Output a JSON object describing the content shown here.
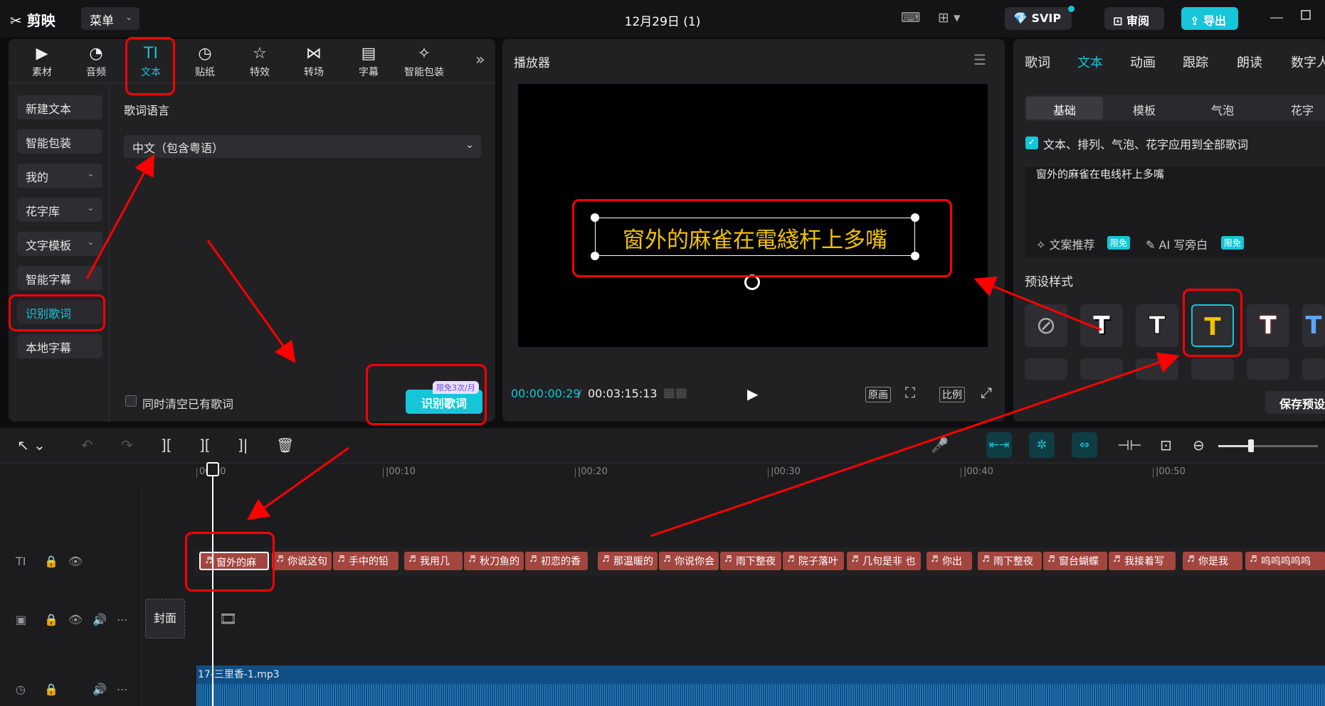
{
  "app": {
    "logo": "✂ 剪映",
    "menu": "菜单",
    "title": "12月29日 (1)",
    "svip": "SVIP",
    "review": "审阅",
    "export": "导出"
  },
  "left_tabs": [
    {
      "label": "素材",
      "icon": "▶"
    },
    {
      "label": "音频",
      "icon": "◔"
    },
    {
      "label": "文本",
      "icon": "TI"
    },
    {
      "label": "贴纸",
      "icon": "◷"
    },
    {
      "label": "特效",
      "icon": "☆"
    },
    {
      "label": "转场",
      "icon": "⋈"
    },
    {
      "label": "字幕",
      "icon": "▤"
    },
    {
      "label": "智能包装",
      "icon": "✧"
    }
  ],
  "sidebar": [
    "新建文本",
    "智能包装",
    "我的",
    "花字库",
    "文字模板",
    "智能字幕",
    "识别歌词",
    "本地字幕"
  ],
  "lyrics": {
    "lang_label": "歌词语言",
    "lang_value": "中文（包含粤语）",
    "clear_label": "同时清空已有歌词",
    "recognize": "识别歌词",
    "limit": "限免3次/月"
  },
  "player": {
    "title": "播放器",
    "caption": "窗外的麻雀在電綫杆上多嘴",
    "time_current": "00:00:00:29",
    "time_sep": "/",
    "time_total": "00:03:15:13",
    "orig": "原画",
    "ratio": "比例"
  },
  "right_tabs": [
    "歌词",
    "文本",
    "动画",
    "跟踪",
    "朗读",
    "数字人"
  ],
  "sub_tabs": [
    "基础",
    "模板",
    "气泡",
    "花字"
  ],
  "text_props": {
    "apply_all": "文本、排列、气泡、花字应用到全部歌词",
    "text_value": "窗外的麻雀在电线杆上多嘴",
    "recommend": "文案推荐",
    "ai_write": "AI 写旁白",
    "free": "限免",
    "preset_label": "预设样式",
    "save_preset": "保存预设"
  },
  "timeline": {
    "ticks": [
      "00:00",
      "|00:10",
      "|00:20",
      "|00:30",
      "|00:40",
      "|00:50"
    ],
    "cover": "封面",
    "audio_name": "17-三里香-1.mp3",
    "clips": [
      "窗外的麻",
      "你说这句",
      "手中的铅",
      "我用几",
      "秋刀鱼的",
      "初恋的香",
      "那温暖的",
      "你说你会",
      "雨下整夜",
      "院子落叶",
      "几句是非 也",
      "你出",
      "雨下整夜",
      "窗台蝴蝶",
      "我接着写",
      "你是我",
      "呜呜呜呜呜"
    ]
  },
  "colors": {
    "accent": "#17c5d8",
    "annotation": "#ff0000",
    "clip": "#a3463f",
    "audio": "#0f4f86"
  }
}
